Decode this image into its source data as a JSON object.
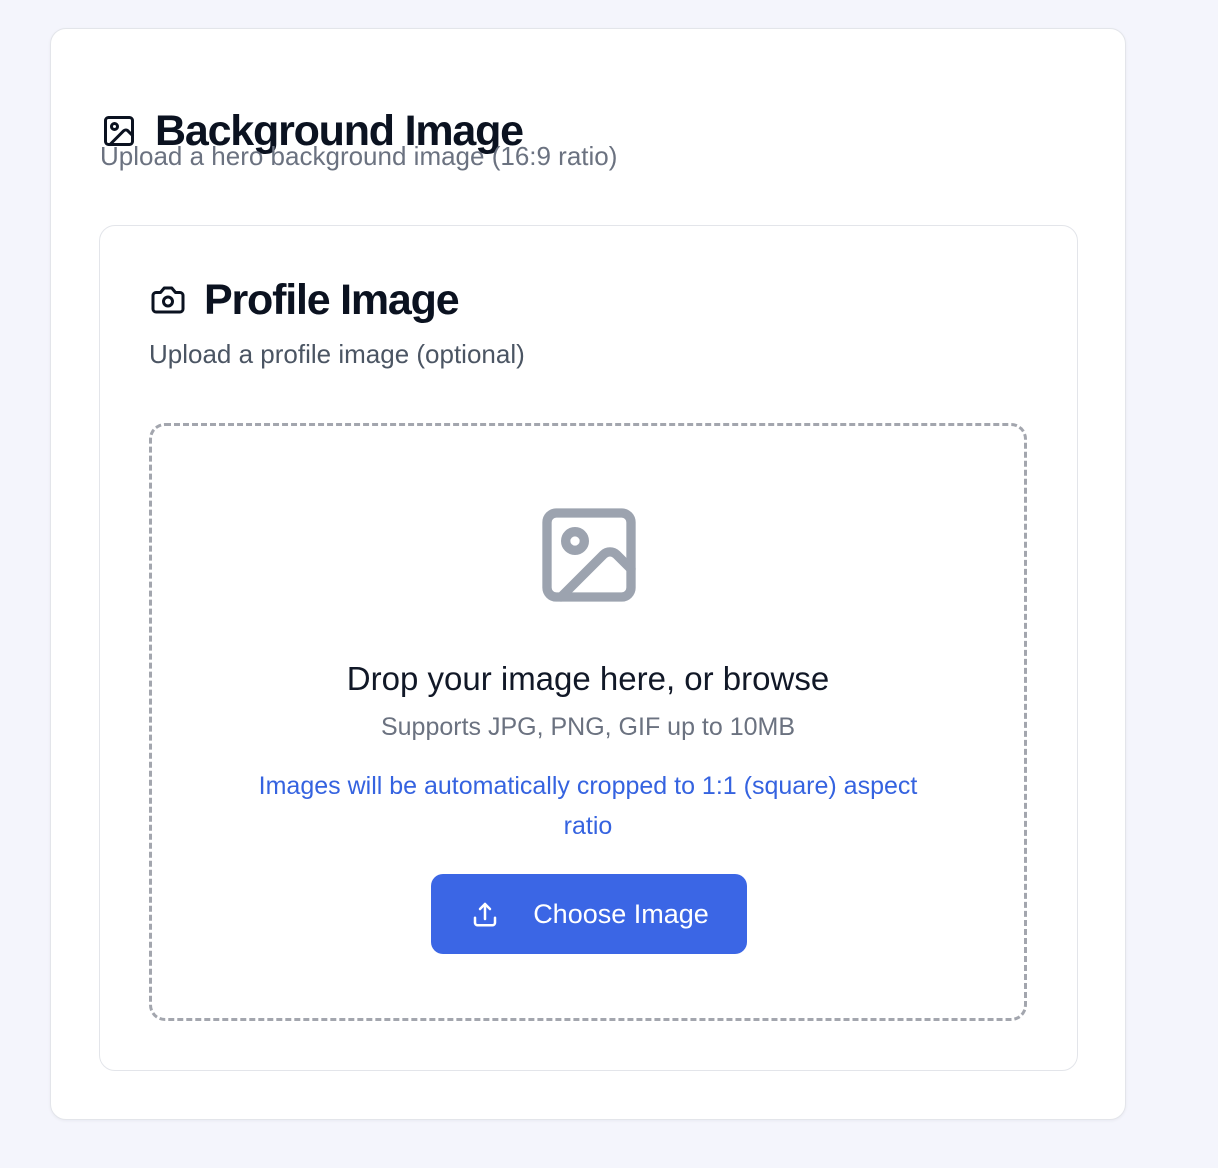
{
  "background_section": {
    "icon": "image-icon",
    "title": "Background Image",
    "subtitle": "Upload a hero background image (16:9 ratio)"
  },
  "profile_section": {
    "icon": "camera-icon",
    "title": "Profile Image",
    "subtitle": "Upload a profile image (optional)"
  },
  "dropzone": {
    "icon": "image-placeholder-icon",
    "title": "Drop your image here, or browse",
    "support_text": "Supports JPG, PNG, GIF up to 10MB",
    "crop_note": "Images will be automatically cropped to 1:1 (square) aspect ratio",
    "button_icon": "upload-icon",
    "button_label": "Choose Image"
  },
  "colors": {
    "accent": "#3b66e5",
    "note_text": "#3563e0",
    "page_background": "#f4f5fc",
    "heading": "#0b1220",
    "muted": "#6b7280",
    "dashed_border": "#a3a6ae"
  }
}
